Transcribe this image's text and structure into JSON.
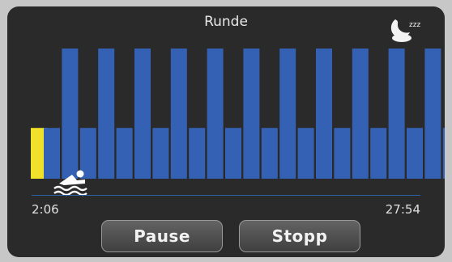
{
  "header": {
    "title": "Runde"
  },
  "icons": {
    "sleep": "sleep-mode-icon",
    "swim": "swimming-icon"
  },
  "timeline": {
    "start_time": "2:06",
    "end_time": "27:54"
  },
  "buttons": {
    "pause_label": "Pause",
    "stop_label": "Stopp"
  },
  "colors": {
    "bar": "#3461b4",
    "start_marker": "#f2e12a",
    "current_marker": "#3ec9e0",
    "timeline": "#2d64a8"
  },
  "chart_data": {
    "type": "bar",
    "title": "",
    "xlabel": "",
    "ylabel": "",
    "ylim": [
      0,
      1
    ],
    "series": [
      {
        "values": [
          0.39,
          1.0,
          0.39,
          1.0,
          0.39,
          1.0,
          0.39,
          1.0,
          0.39,
          1.0,
          0.39,
          1.0,
          0.39,
          1.0,
          0.39,
          1.0,
          0.39,
          1.0,
          0.39,
          1.0,
          0.39,
          1.0,
          0.39
        ]
      }
    ],
    "start_marker_value": 0.39,
    "end_marker_value": 0.39
  }
}
